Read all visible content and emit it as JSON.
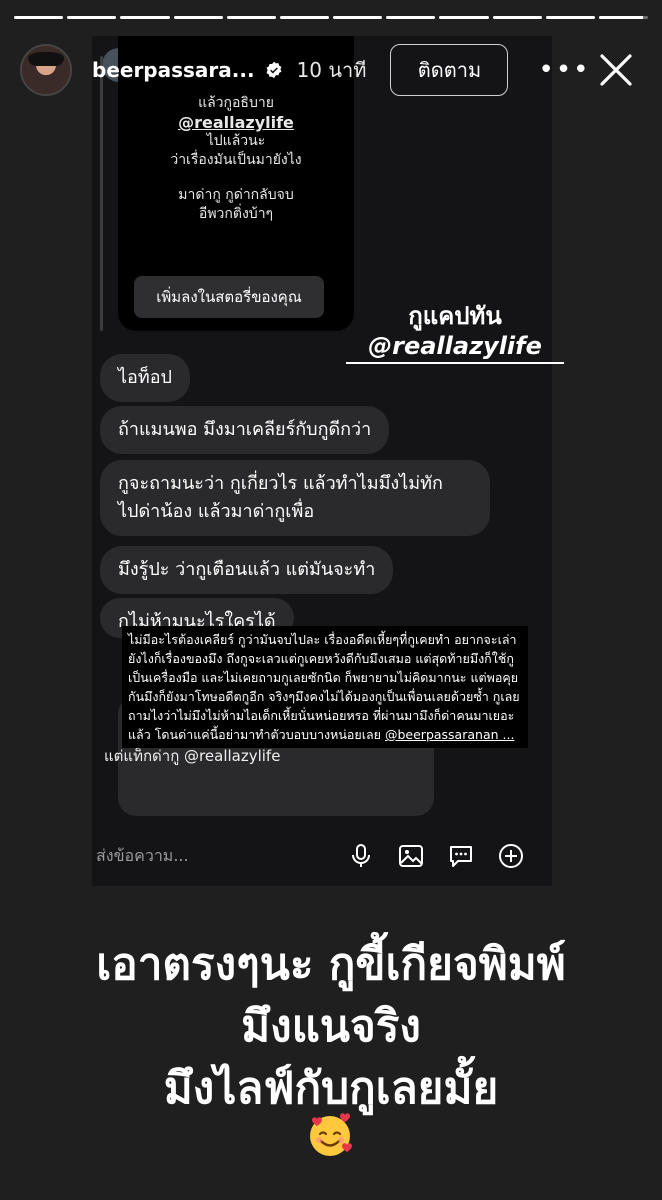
{
  "progress": {
    "segments": 12,
    "completed": 11,
    "current_fraction": 0.9
  },
  "header": {
    "username": "beerpassara...",
    "time": "10 นาที",
    "follow_label": "ติดตาม",
    "more_icon": "more-icon",
    "close_icon": "close-icon"
  },
  "shot": {
    "story_card": {
      "lines": [
        "แล้วกูอธิบาย",
        "@reallazylife",
        "ไปแล้วนะ",
        "ว่าเรื่องมันเป็นมายังไง",
        "มาด่ากู กูด่ากลับจบ",
        "อีพวกติ่งบ้าๆ"
      ],
      "button": "เพิ่มลงในสตอรี่ของคุณ"
    },
    "messages": [
      "ไอท็อป",
      "ถ้าแมนพอ มึงมาเคลียร์กับกูดีกว่า",
      "กูจะถามนะว่า กูเกี่ยวไร แล้วทำไมมึงไม่ทัก\nไปด่าน้อง แล้วมาด่ากูเพื่อ",
      "มึงรู้ปะ ว่ากูเตือนแล้ว แต่มันจะทำ",
      "กูไม่ห้ามนะไรใครได้"
    ],
    "reply_text": "แต่แท็กด่ากู @reallazylife",
    "input_placeholder": "ส่งข้อความ..."
  },
  "overlay": {
    "text": "ไม่มีอะไรต้องเคลียร์ กูว่ามันจบไปละ เรื่องอดีตเหี้ยๆที่กูเคยทำ อยากจะเล่ายังไงก็เรื่องของมึง ถึงกูจะเลวแต่กูเคยหวังดีกับมึงเสมอ แต่สุดท้ายมึงก็ใช้กูเป็นเครื่องมือ และไม่เคยถามกูเลยซักนิด ก็พยายามไม่คิดมากนะ แต่พอคุยกันมึงก็ยังมาโทษอดีตกูอีก จริงๆมึงคงไม่ได้มองกูเป็นเพื่อนเลยด้วยซ้ำ กูเลยถามไงว่าไม่มึงไม่ห้ามไอเด็กเหี้ยนั่นหน่อยหรอ ที่ผ่านมามึงก็ด่าคนมาเยอะแล้ว โดนด่าแค่นี้อย่ามาทำตัวบอบบางหน่อยเลย",
    "tag": "@beerpassaranan ..."
  },
  "sticker": {
    "line": "กูแคปทัน",
    "mention": "@reallazylife"
  },
  "caption": {
    "lines": [
      "เอาตรงๆนะ กูขี้เกียจพิมพ์",
      "มึงแนจริง",
      "มึงไลฟ์กับกูเลยมั้ย"
    ],
    "emoji": "smiling-face-with-hearts"
  }
}
